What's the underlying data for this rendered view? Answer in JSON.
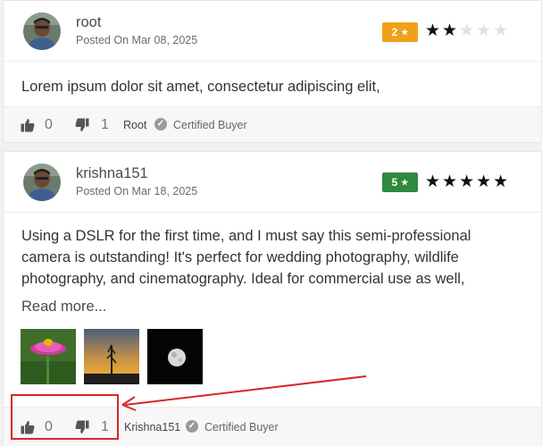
{
  "reviews": [
    {
      "user": "root",
      "posted": "Posted On Mar 08, 2025",
      "rating": "2",
      "rating_star": "★",
      "stars": {
        "filled": "★★",
        "empty": "★★★"
      },
      "body": "Lorem ipsum dolor sit amet, consectetur adipiscing elit,",
      "likes": "0",
      "dislikes": "1",
      "author": "Root",
      "certified": "Certified Buyer"
    },
    {
      "user": "krishna151",
      "posted": "Posted On Mar 18, 2025",
      "rating": "5",
      "rating_star": "★",
      "stars": {
        "filled": "★★★★★",
        "empty": ""
      },
      "body": "Using a DSLR for the first time, and I must say this semi-professional camera is outstanding! It's perfect for wedding photography, wildlife photography, and cinematography. Ideal for commercial use as well,",
      "read_more": "Read more...",
      "thumbnails": [
        "flower-photo",
        "sunset-plant-photo",
        "moon-photo"
      ],
      "likes": "0",
      "dislikes": "1",
      "author": "Krishna151",
      "certified": "Certified Buyer"
    }
  ],
  "colors": {
    "rating_two": "#f0a11a",
    "rating_five": "#2e8b3d",
    "annotation": "#d62828"
  }
}
